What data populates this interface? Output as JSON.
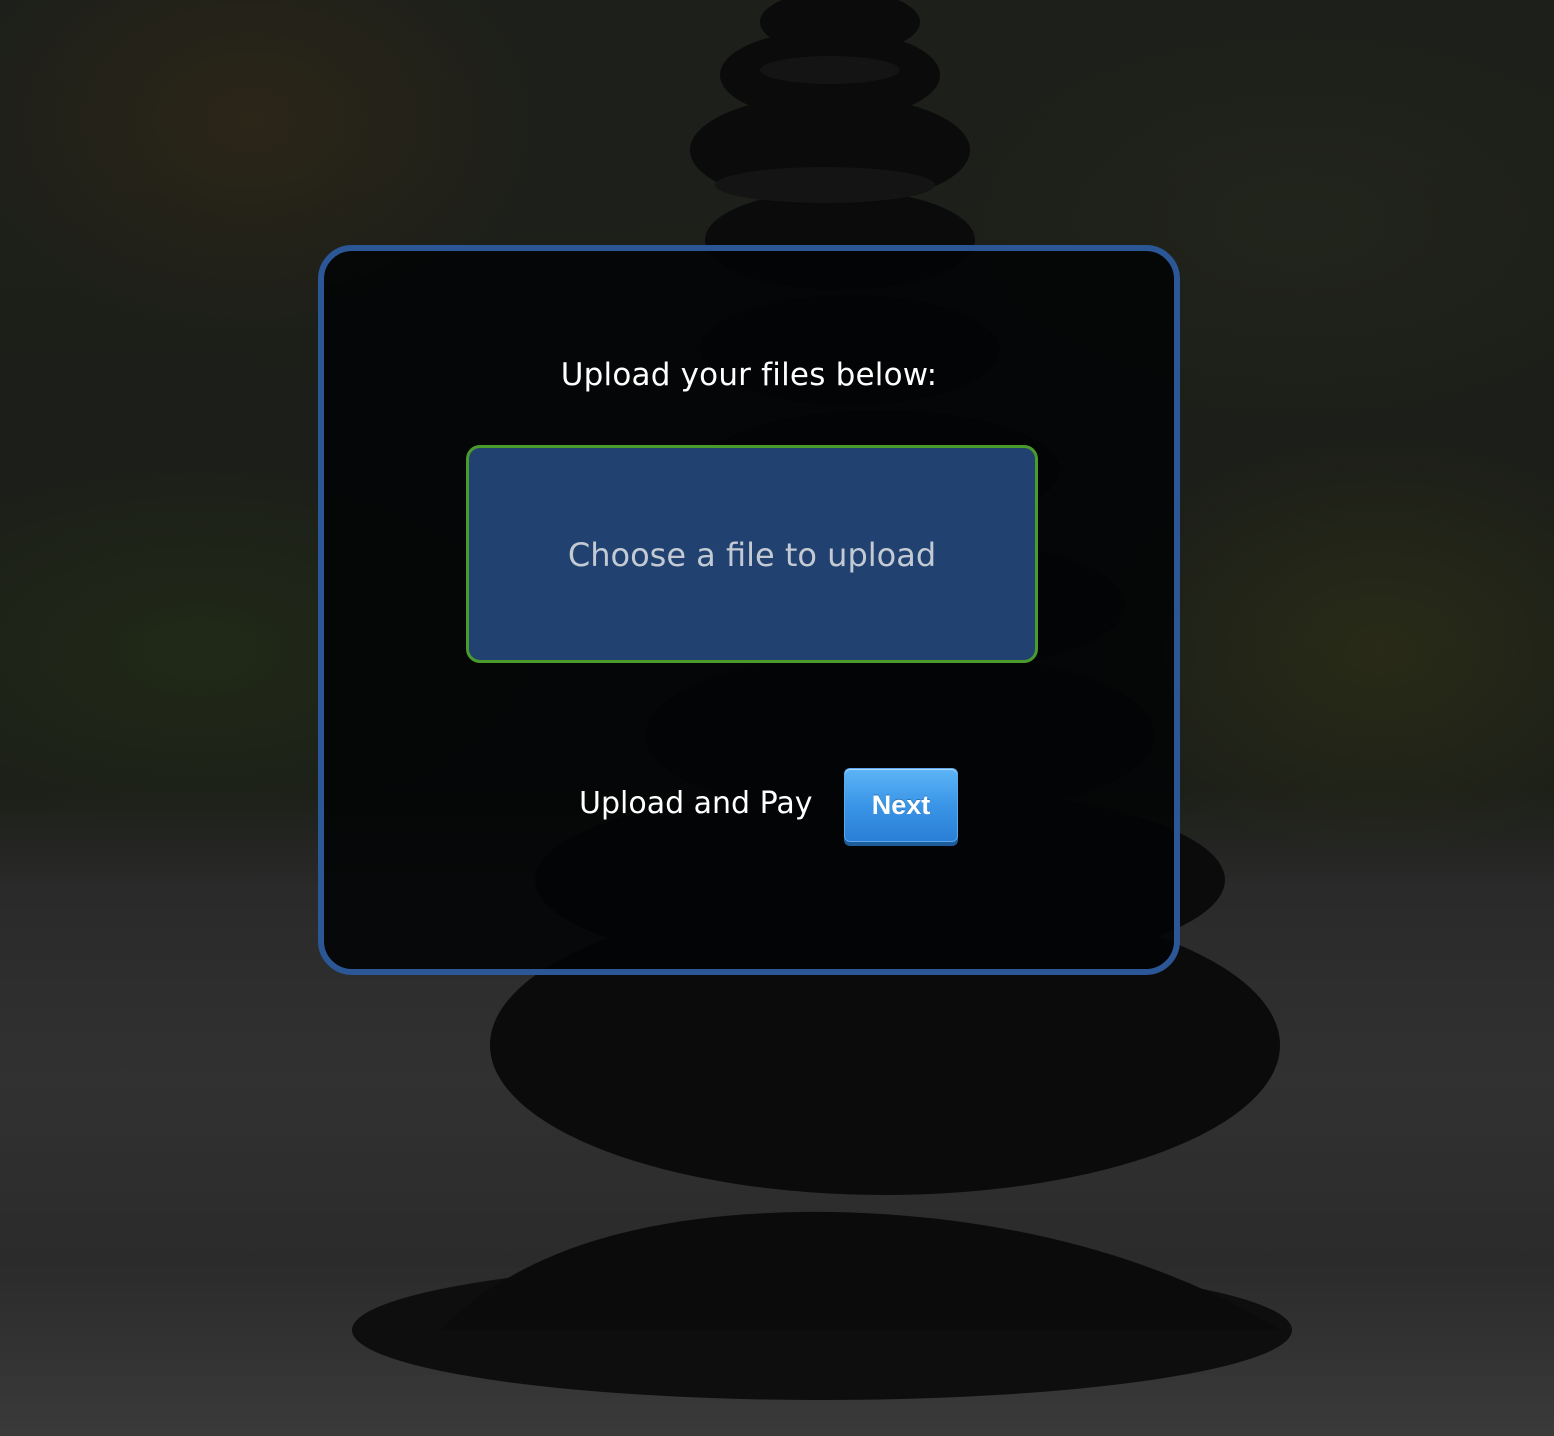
{
  "upload": {
    "heading": "Upload your files below:",
    "dropzone_label": "Choose a file to upload",
    "pay_label": "Upload and Pay",
    "next_label": "Next"
  },
  "colors": {
    "card_border": "#2b5796",
    "dropzone_fill": "#214270",
    "dropzone_border": "#4a9a2c",
    "button_fill": "#3a95e7"
  }
}
